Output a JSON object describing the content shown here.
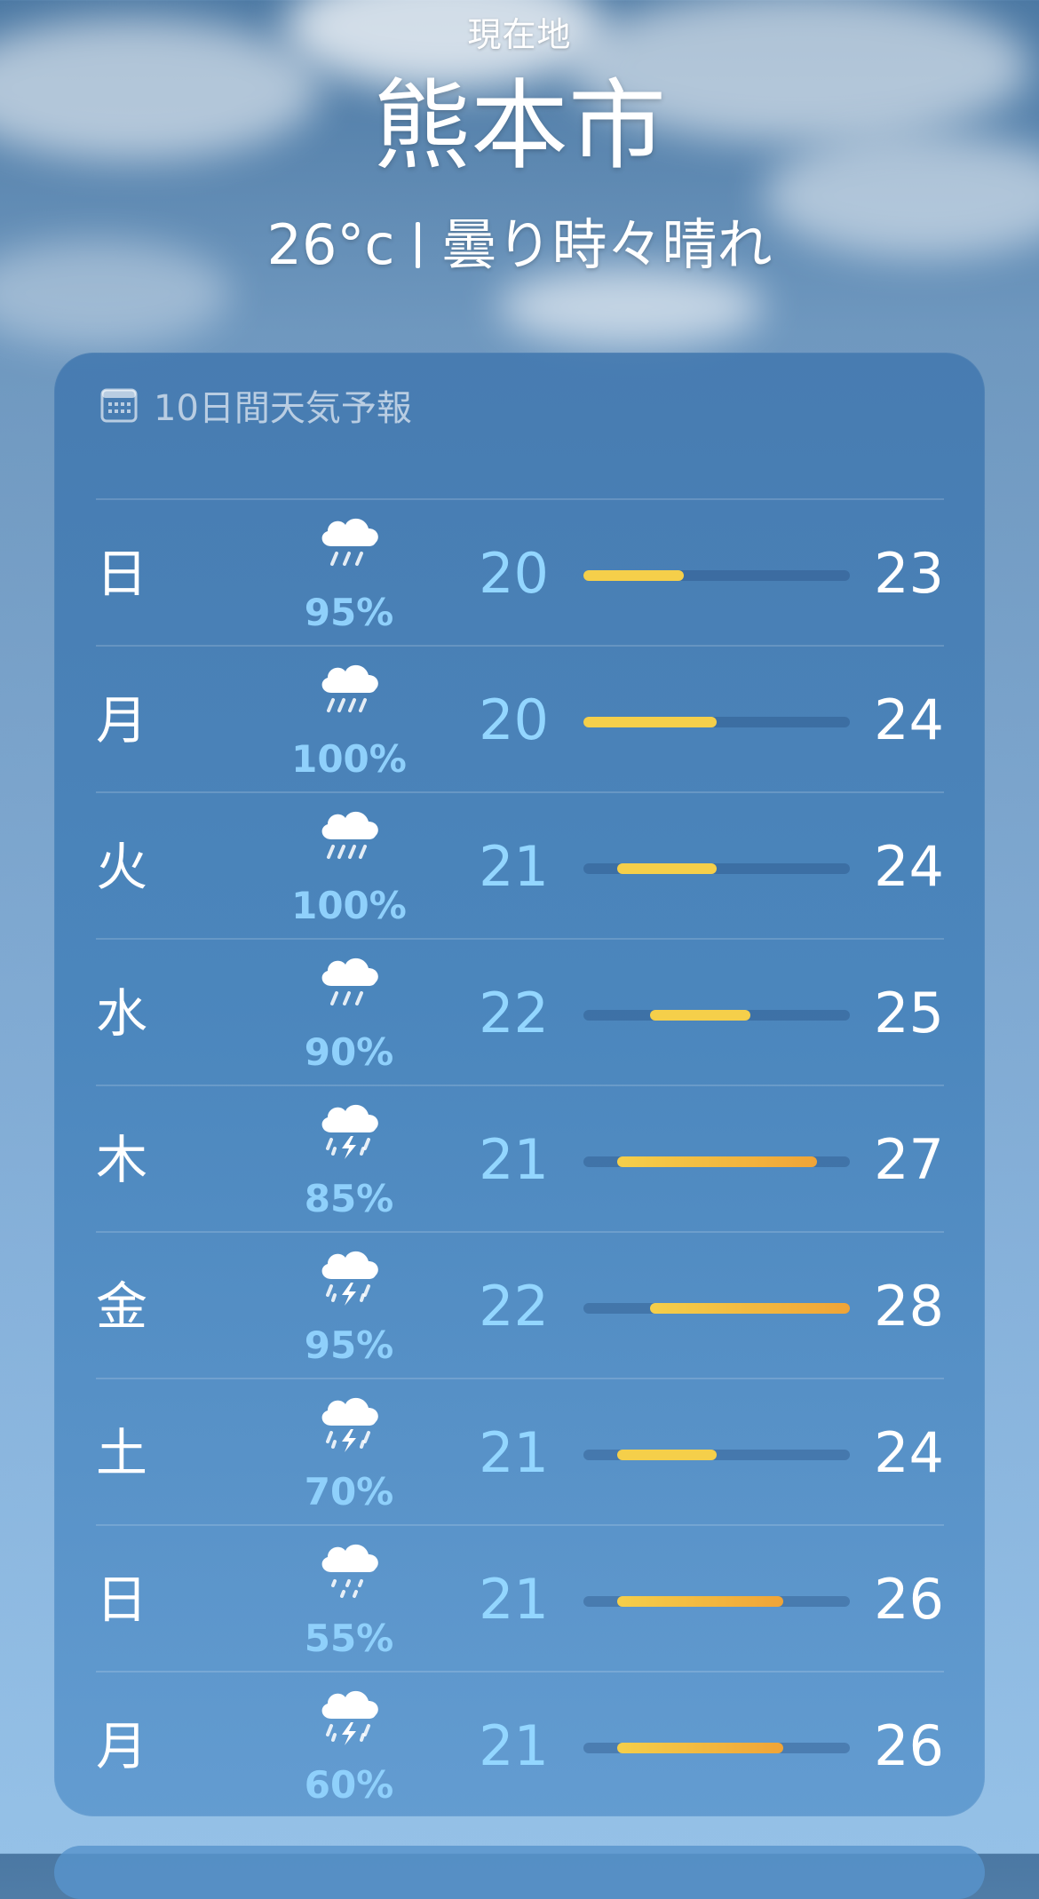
{
  "header": {
    "location_label": "現在地",
    "city": "熊本市",
    "current_temp": "26°c",
    "current_condition": "曇り時々晴れ"
  },
  "forecast": {
    "title": "10日間天気予報",
    "icon": "calendar-icon",
    "scale_min": 20,
    "scale_max": 28,
    "days": [
      {
        "day": "日",
        "icon": "cloud-rain-icon",
        "precip": "95%",
        "low": "20",
        "high": "23"
      },
      {
        "day": "月",
        "icon": "cloud-heavy-rain-icon",
        "precip": "100%",
        "low": "20",
        "high": "24"
      },
      {
        "day": "火",
        "icon": "cloud-heavy-rain-icon",
        "precip": "100%",
        "low": "21",
        "high": "24"
      },
      {
        "day": "水",
        "icon": "cloud-rain-icon",
        "precip": "90%",
        "low": "22",
        "high": "25"
      },
      {
        "day": "木",
        "icon": "cloud-bolt-rain-icon",
        "precip": "85%",
        "low": "21",
        "high": "27"
      },
      {
        "day": "金",
        "icon": "cloud-bolt-rain-icon",
        "precip": "95%",
        "low": "22",
        "high": "28"
      },
      {
        "day": "土",
        "icon": "cloud-bolt-rain-icon",
        "precip": "70%",
        "low": "21",
        "high": "24"
      },
      {
        "day": "日",
        "icon": "cloud-drizzle-icon",
        "precip": "55%",
        "low": "21",
        "high": "26"
      },
      {
        "day": "月",
        "icon": "cloud-bolt-rain-icon",
        "precip": "60%",
        "low": "21",
        "high": "26"
      }
    ]
  },
  "colors": {
    "bar_warm": "#f5cf4a",
    "bar_hot": "#f0a437",
    "low_temp": "#93d6ff",
    "precip": "#8fd0fb"
  }
}
